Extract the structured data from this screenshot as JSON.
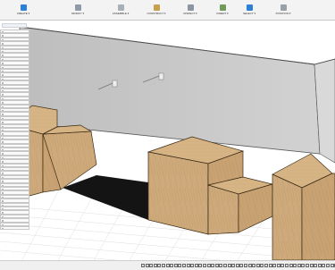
{
  "app": {
    "title": "",
    "colors": {
      "accent": "#2f7fd8",
      "wall": "#c9c9c9",
      "wood": "#c9a77a",
      "shadow": "#141414",
      "grid": "#dcdcdc"
    }
  },
  "toolbar": {
    "title": "",
    "subtitle": "CREATE ▾",
    "buttons": [
      {
        "label": "MODIFY ▾",
        "icon": "modify-icon",
        "color": "#8e9aa7"
      },
      {
        "label": "ASSEMBLE ▾",
        "icon": "assemble-icon",
        "color": "#a7b0b8"
      },
      {
        "label": "CONSTRUCT ▾",
        "icon": "construct-icon",
        "color": "#c7a04e"
      },
      {
        "label": "INSPECT ▾",
        "icon": "inspect-icon",
        "color": "#8c96a2"
      },
      {
        "label": "INSERT ▾",
        "icon": "insert-icon",
        "color": "#6f9a5a"
      },
      {
        "label": "SELECT ▾",
        "icon": "select-icon",
        "color": "#2f7fd8"
      },
      {
        "label": "POSITION ▾",
        "icon": "position-icon",
        "color": "#9aa0a8"
      }
    ]
  },
  "sidebar": {
    "header": "",
    "items": [
      {
        "label": ""
      },
      {
        "label": ""
      },
      {
        "label": ""
      },
      {
        "label": ""
      },
      {
        "label": ""
      },
      {
        "label": ""
      },
      {
        "label": ""
      },
      {
        "label": ""
      },
      {
        "label": ""
      },
      {
        "label": ""
      },
      {
        "label": ""
      },
      {
        "label": ""
      },
      {
        "label": ""
      },
      {
        "label": ""
      },
      {
        "label": ""
      },
      {
        "label": ""
      },
      {
        "label": ""
      },
      {
        "label": ""
      },
      {
        "label": ""
      },
      {
        "label": ""
      },
      {
        "label": ""
      },
      {
        "label": ""
      },
      {
        "label": ""
      },
      {
        "label": ""
      },
      {
        "label": ""
      },
      {
        "label": ""
      },
      {
        "label": ""
      },
      {
        "label": ""
      },
      {
        "label": ""
      },
      {
        "label": ""
      },
      {
        "label": ""
      },
      {
        "label": ""
      },
      {
        "label": ""
      },
      {
        "label": ""
      },
      {
        "label": ""
      },
      {
        "label": ""
      },
      {
        "label": ""
      },
      {
        "label": ""
      },
      {
        "label": ""
      },
      {
        "label": ""
      },
      {
        "label": ""
      },
      {
        "label": ""
      },
      {
        "label": ""
      },
      {
        "label": ""
      },
      {
        "label": ""
      },
      {
        "label": ""
      },
      {
        "label": ""
      },
      {
        "label": ""
      },
      {
        "label": ""
      },
      {
        "label": ""
      },
      {
        "label": ""
      }
    ]
  },
  "bottombar": {
    "label": "",
    "icons": [
      "timeline-icon",
      "timeline-icon",
      "timeline-icon",
      "timeline-icon",
      "timeline-icon",
      "timeline-icon",
      "timeline-icon",
      "timeline-icon",
      "timeline-icon",
      "timeline-icon",
      "timeline-icon",
      "timeline-icon",
      "timeline-icon",
      "timeline-icon",
      "timeline-icon",
      "timeline-icon",
      "timeline-icon",
      "timeline-icon",
      "timeline-icon",
      "timeline-icon",
      "timeline-icon",
      "timeline-icon",
      "timeline-icon",
      "timeline-icon",
      "timeline-icon",
      "timeline-icon",
      "timeline-icon",
      "timeline-icon",
      "timeline-icon",
      "timeline-icon",
      "timeline-icon",
      "timeline-icon",
      "timeline-icon",
      "timeline-icon",
      "timeline-icon",
      "timeline-icon",
      "timeline-icon",
      "timeline-icon",
      "timeline-icon",
      "timeline-icon",
      "timeline-icon",
      "timeline-icon",
      "timeline-icon",
      "timeline-icon",
      "timeline-icon",
      "timeline-icon",
      "timeline-icon",
      "timeline-icon",
      "timeline-icon",
      "timeline-icon",
      "timeline-icon",
      "timeline-icon",
      "timeline-icon",
      "timeline-icon",
      "timeline-icon",
      "timeline-icon",
      "timeline-icon",
      "timeline-icon",
      "timeline-icon",
      "timeline-icon"
    ]
  }
}
